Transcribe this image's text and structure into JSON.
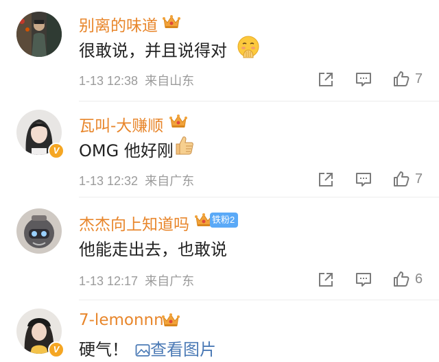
{
  "comments": [
    {
      "username": "别离的味道",
      "text": "很敢说，并且说得对",
      "time": "1-13 12:38",
      "location": "来自山东",
      "likes": "7",
      "has_v_badge": false,
      "emoji": "shush-face"
    },
    {
      "username": "瓦叫-大赚顺",
      "text": "OMG 他好刚",
      "time": "1-13 12:32",
      "location": "来自广东",
      "likes": "7",
      "has_v_badge": true,
      "emoji": "thumbs-up"
    },
    {
      "username": "杰杰向上知道吗",
      "text": "他能走出去，也敢说",
      "time": "1-13 12:17",
      "location": "来自广东",
      "likes": "6",
      "fan_badge": "铁粉2",
      "has_v_badge": false
    },
    {
      "username": "7-lemonnn",
      "text": "硬气！",
      "image_link": "查看图片",
      "has_v_badge": true
    }
  ],
  "colors": {
    "username": "#e8862b",
    "text": "#222222",
    "meta": "#9b9b9b",
    "link": "#4a79b5",
    "divider": "#ececec",
    "crown": "#f2a33a",
    "fan_badge": "#5aa9f7"
  },
  "icons": {
    "share": "share-icon",
    "comment": "comment-icon",
    "like": "thumbs-up-icon",
    "crown": "crown-icon",
    "image": "image-icon"
  }
}
